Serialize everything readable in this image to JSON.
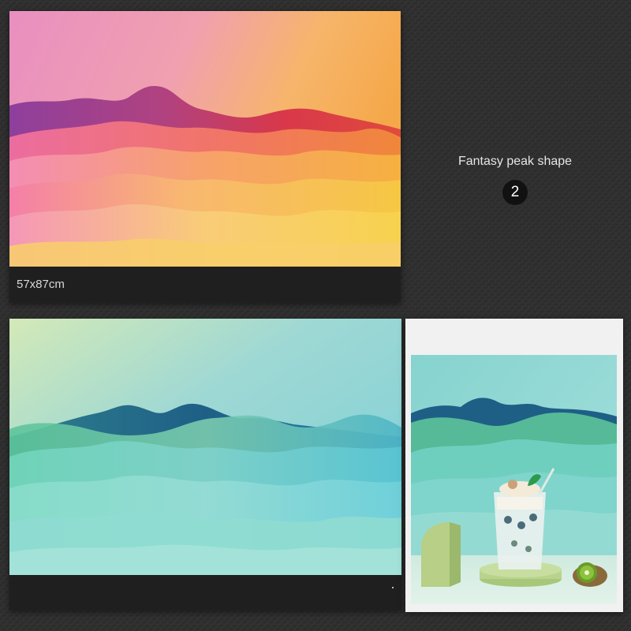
{
  "card_warm": {
    "size_label": "57x87cm",
    "palette": {
      "sky_top": "#e98fc0",
      "sky_right": "#f5b95a",
      "peak_purple": "#9a3f9a",
      "peak_red": "#d9384a",
      "mid_orange": "#f08a3a",
      "low_yellow": "#f6c743",
      "low_pink": "#f27fa8"
    }
  },
  "card_teal": {
    "palette": {
      "sky": "#8fd5d8",
      "sky_light": "#cfe9c4",
      "peak_navy": "#1e5f86",
      "mid_green": "#6fc7a8",
      "low_teal": "#5ecfd0"
    }
  },
  "card_scene": {
    "props": [
      "drink-glass-icon",
      "kiwi-icon",
      "mint-leaf-icon",
      "arch-prop-icon",
      "round-pedestal-icon"
    ]
  },
  "caption": {
    "title": "Fantasy peak shape",
    "number": "2"
  }
}
